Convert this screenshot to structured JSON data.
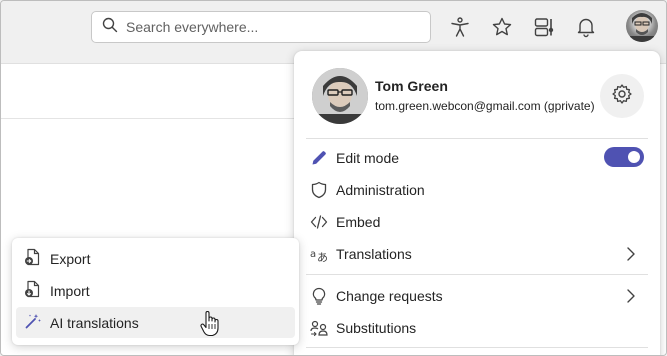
{
  "search": {
    "placeholder": "Search everywhere..."
  },
  "profile": {
    "name": "Tom Green",
    "email": "tom.green.webcon@gmail.com (gprivate)",
    "items": [
      {
        "label": "Edit mode",
        "icon": "pencil-icon",
        "toggle": true
      },
      {
        "label": "Administration",
        "icon": "shield-icon"
      },
      {
        "label": "Embed",
        "icon": "code-icon"
      },
      {
        "label": "Translations",
        "icon": "translate-icon",
        "has_submenu": true
      },
      {
        "label": "Change requests",
        "icon": "lightbulb-icon",
        "has_submenu": true
      },
      {
        "label": "Substitutions",
        "icon": "people-swap-icon"
      }
    ]
  },
  "submenu": {
    "items": [
      {
        "label": "Export",
        "icon": "document-export-icon"
      },
      {
        "label": "Import",
        "icon": "document-import-icon"
      },
      {
        "label": "AI translations",
        "icon": "magic-wand-icon"
      }
    ]
  },
  "colors": {
    "accent": "#4f52b2",
    "background": "#f0f0f0"
  }
}
